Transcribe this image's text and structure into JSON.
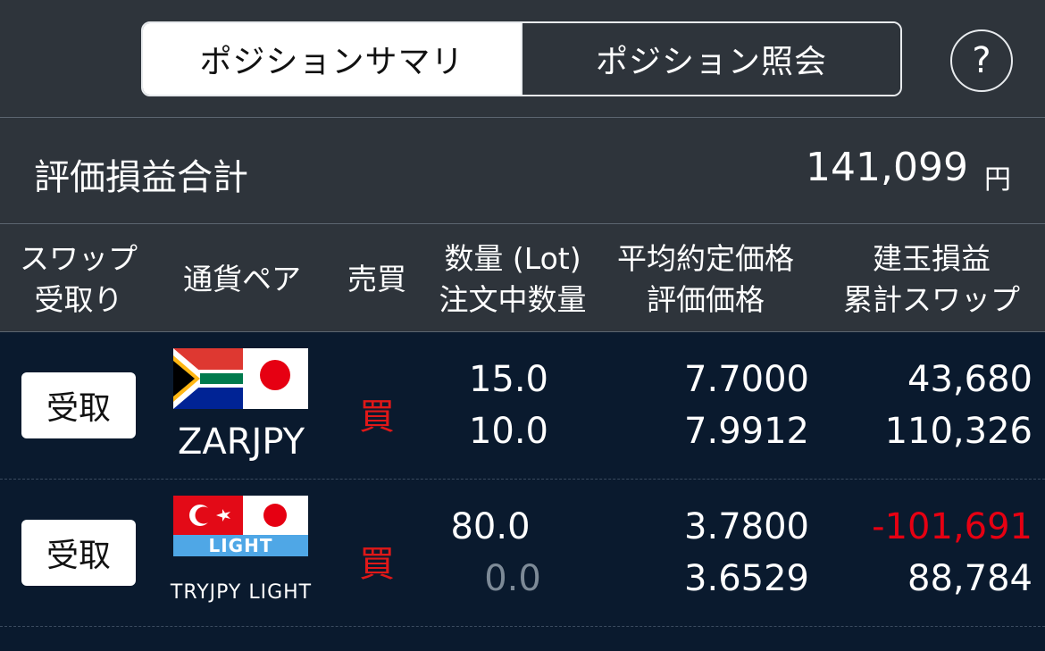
{
  "tabs": {
    "summary_label": "ポジションサマリ",
    "inquiry_label": "ポジション照会",
    "help_label": "?"
  },
  "summary": {
    "label": "評価損益合計",
    "value": "141,099",
    "unit": "円"
  },
  "columns": {
    "swap_line1": "スワップ",
    "swap_line2": "受取り",
    "pair": "通貨ペア",
    "side": "売買",
    "qty_line1": "数量 (Lot)",
    "qty_line2": "注文中数量",
    "price_line1": "平均約定価格",
    "price_line2": "評価価格",
    "pl_line1": "建玉損益",
    "pl_line2": "累計スワップ"
  },
  "rows": [
    {
      "receive_label": "受取",
      "pair": "ZARJPY",
      "side": "買",
      "quantity": "15.0",
      "order_quantity": "10.0",
      "avg_price": "7.7000",
      "eval_price": "7.9912",
      "position_pl": "43,680",
      "cumulative_swap": "110,326",
      "flag_icon": "south-africa-japan-flag-icon"
    },
    {
      "receive_label": "受取",
      "pair": "TRYJPY LIGHT",
      "flag_badge": "LIGHT",
      "side": "買",
      "quantity": "80.0",
      "order_quantity": "0.0",
      "avg_price": "3.7800",
      "eval_price": "3.6529",
      "position_pl": "-101,691",
      "cumulative_swap": "88,784",
      "flag_icon": "turkey-japan-light-flag-icon"
    }
  ],
  "colors": {
    "header_bg": "#2e343b",
    "rows_bg": "#0a1a2e",
    "buy": "#e01818",
    "negative": "#e60012",
    "dim": "#7d8a97"
  }
}
